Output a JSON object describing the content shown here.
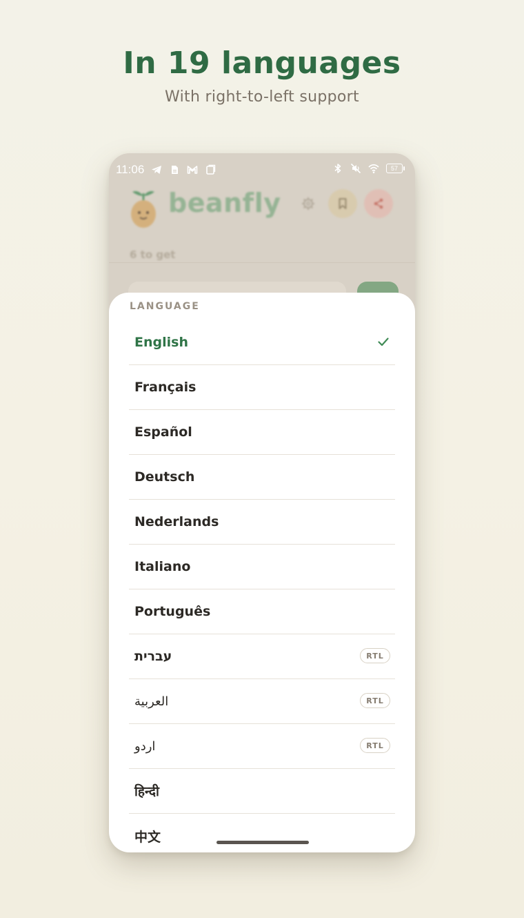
{
  "promo": {
    "headline": "In 19 languages",
    "subhead": "With right-to-left support"
  },
  "status_bar": {
    "time": "11:06",
    "battery": "57"
  },
  "app": {
    "brand": "beanfly",
    "to_get": "6 to get"
  },
  "sheet": {
    "title": "LANGUAGE",
    "rtl_badge": "RTL",
    "languages": [
      {
        "label": "English",
        "selected": true,
        "rtl": false
      },
      {
        "label": "Français",
        "selected": false,
        "rtl": false
      },
      {
        "label": "Español",
        "selected": false,
        "rtl": false
      },
      {
        "label": "Deutsch",
        "selected": false,
        "rtl": false
      },
      {
        "label": "Nederlands",
        "selected": false,
        "rtl": false
      },
      {
        "label": "Italiano",
        "selected": false,
        "rtl": false
      },
      {
        "label": "Português",
        "selected": false,
        "rtl": false
      },
      {
        "label": "עברית",
        "selected": false,
        "rtl": true
      },
      {
        "label": "العربية",
        "selected": false,
        "rtl": true
      },
      {
        "label": "اردو",
        "selected": false,
        "rtl": true
      },
      {
        "label": "हिन्दी",
        "selected": false,
        "rtl": false
      },
      {
        "label": "中文",
        "selected": false,
        "rtl": false
      }
    ]
  },
  "colors": {
    "accent_green": "#2f7447",
    "headline_green": "#2f6b44",
    "background": "#f3f1e6"
  },
  "icons": {
    "selected_marker": "checkmark-icon",
    "status_left": [
      "telegram-icon",
      "document-icon",
      "gmail-icon",
      "copy-icon"
    ],
    "status_right": [
      "bluetooth-icon",
      "mute-icon",
      "wifi-icon",
      "battery-icon"
    ],
    "header": [
      "mascot-icon",
      "gear-icon",
      "bookmark-icon",
      "share-icon"
    ]
  }
}
